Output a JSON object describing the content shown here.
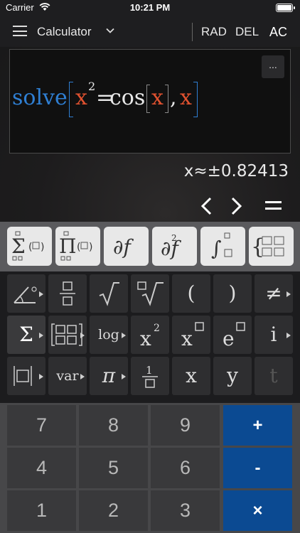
{
  "status_bar": {
    "carrier": "Carrier",
    "time": "10:21 PM"
  },
  "toolbar": {
    "title": "Calculator",
    "rad_label": "RAD",
    "del_label": "DEL",
    "ac_label": "AC"
  },
  "editor": {
    "menu_label": "...",
    "expression": {
      "func": "solve",
      "var1": "x",
      "exp": "2",
      "eq": "=",
      "cos": "cos",
      "var2": "x",
      "comma": ",",
      "var3": "x"
    }
  },
  "result": {
    "text": "x≈±0.82413"
  },
  "templates": [
    "Σ(□)",
    "Π(□)",
    "∂f",
    "∂²f",
    "∫□",
    "{□□"
  ],
  "function_keys": {
    "row1": [
      "∠°",
      "□/□",
      "√",
      "□√",
      "(",
      ")",
      "≠"
    ],
    "row2": [
      "Σ",
      "[□□]",
      "log",
      "x²",
      "x□",
      "e□",
      "i"
    ],
    "row3": [
      "|□|",
      "var",
      "π",
      "1/□",
      "x",
      "y",
      "t"
    ]
  },
  "number_keys": {
    "row1": [
      "7",
      "8",
      "9",
      "+"
    ],
    "row2": [
      "4",
      "5",
      "6",
      "-"
    ],
    "row3": [
      "1",
      "2",
      "3",
      "×"
    ]
  },
  "colors": {
    "accent_blue": "#2f7fd3",
    "variable_red": "#e0512f",
    "operator_key": "#0b4a92"
  }
}
